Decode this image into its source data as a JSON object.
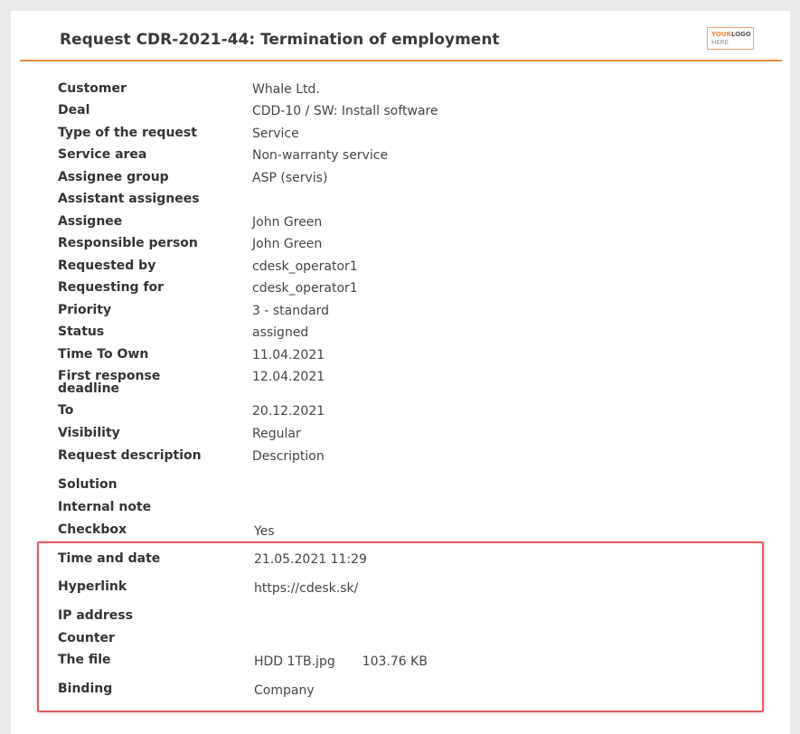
{
  "header": {
    "title": "Request CDR-2021-44: Termination of employment",
    "logo": {
      "line1a": "YOUR",
      "line1b": "LOGO",
      "line2": "HERE"
    }
  },
  "fields": [
    {
      "label": "Customer",
      "value": "Whale Ltd."
    },
    {
      "label": "Deal",
      "value": "CDD-10 / SW: Install software"
    },
    {
      "label": "Type of the request",
      "value": "Service"
    },
    {
      "label": "Service area",
      "value": "Non-warranty service"
    },
    {
      "label": "Assignee group",
      "value": "ASP (servis)"
    },
    {
      "label": "Assistant assignees",
      "value": ""
    },
    {
      "label": "Assignee",
      "value": "John Green"
    },
    {
      "label": "Responsible person",
      "value": "John Green"
    },
    {
      "label": "Requested by",
      "value": "cdesk_operator1"
    },
    {
      "label": "Requesting for",
      "value": "cdesk_operator1"
    },
    {
      "label": "Priority",
      "value": "3 - standard"
    },
    {
      "label": "Status",
      "value": "assigned"
    },
    {
      "label": "Time To Own",
      "value": "11.04.2021"
    },
    {
      "label": "First response deadline",
      "value": "12.04.2021"
    },
    {
      "label": "To",
      "value": "20.12.2021"
    },
    {
      "label": "Visibility",
      "value": "Regular"
    },
    {
      "label": "Request description",
      "value": "Description"
    },
    {
      "label": "Solution",
      "value": ""
    },
    {
      "label": "Internal note",
      "value": ""
    },
    {
      "label": "Checkbox",
      "value": "Yes"
    },
    {
      "label": "Time and date",
      "value": "21.05.2021 11:29"
    },
    {
      "label": "Hyperlink",
      "value": "https://cdesk.sk/"
    },
    {
      "label": "IP address",
      "value": ""
    },
    {
      "label": "Counter",
      "value": ""
    },
    {
      "label": "The file",
      "value": "HDD 1TB.jpg",
      "size": "103.76 KB"
    },
    {
      "label": "Binding",
      "value": "Company"
    }
  ]
}
